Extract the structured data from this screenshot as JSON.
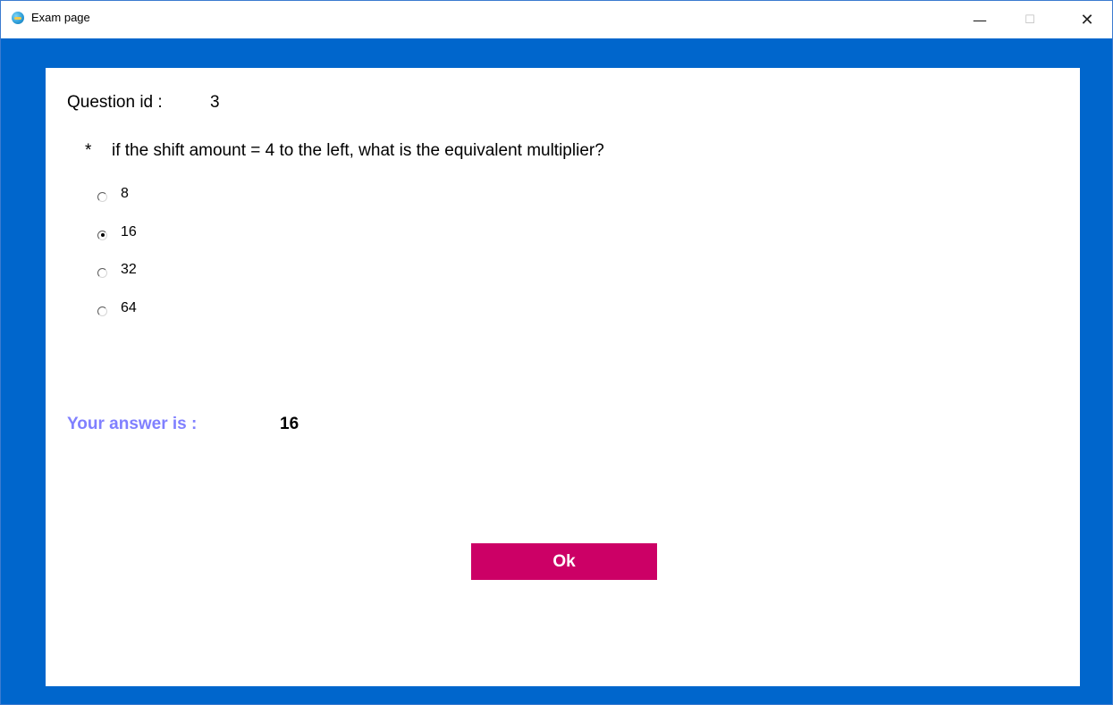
{
  "window": {
    "title": "Exam page",
    "icon": "app-icon",
    "controls": {
      "minimize": "—",
      "maximize": "☐",
      "close": "✕"
    }
  },
  "question": {
    "id_label": "Question id :",
    "id_value": "3",
    "bullet": "*",
    "text": "if the shift amount = 4 to the left, what is the equivalent multiplier?"
  },
  "options": [
    {
      "label": "8",
      "selected": false
    },
    {
      "label": "16",
      "selected": true
    },
    {
      "label": "32",
      "selected": false
    },
    {
      "label": "64",
      "selected": false
    }
  ],
  "answer": {
    "label": "Your answer is :",
    "value": "16"
  },
  "ok_button": {
    "label": "Ok"
  },
  "colors": {
    "frame": "#0066cc",
    "answer_label": "#8080ff",
    "ok_button": "#cc0066"
  }
}
